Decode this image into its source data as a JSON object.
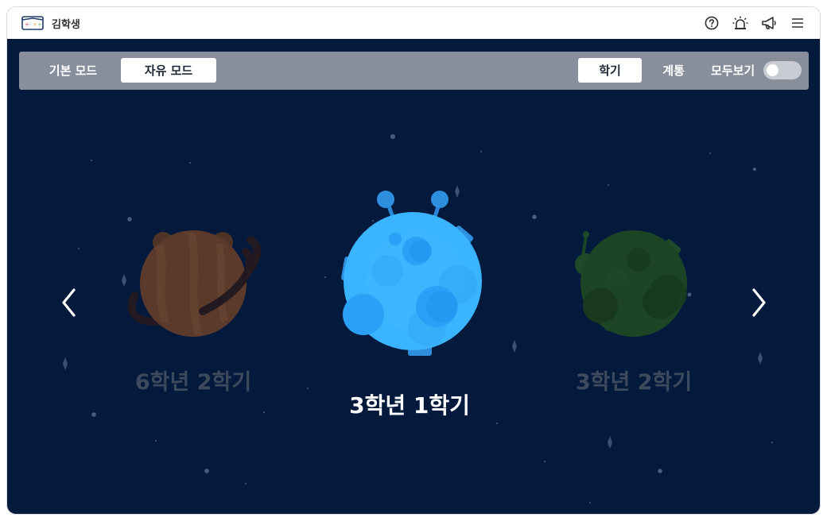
{
  "titlebar": {
    "user_name": "김학생",
    "icons": [
      "logo-icon",
      "help-icon",
      "alarm-icon",
      "megaphone-icon",
      "menu-icon"
    ]
  },
  "toolbar": {
    "mode_basic": "기본 모드",
    "mode_free": "자유 모드",
    "segment_semester": "학기",
    "segment_strand": "계통",
    "show_all_label": "모두보기",
    "show_all_enabled": false,
    "selected_mode": "자유 모드",
    "selected_segment": "학기"
  },
  "carousel": {
    "left_label": "6학년 2학기",
    "center_label": "3학년 1학기",
    "right_label": "3학년 2학기",
    "prev_icon": "chevron-left-icon",
    "next_icon": "chevron-right-icon"
  },
  "colors": {
    "stage_bg": "#031a3c",
    "toolbar_bg": "#878f9c",
    "planet_left": "#5b3a2c",
    "planet_center": "#3bb4ff",
    "planet_right": "#1c4526",
    "label_dim": "#3d4a5e",
    "label_active": "#ffffff"
  }
}
